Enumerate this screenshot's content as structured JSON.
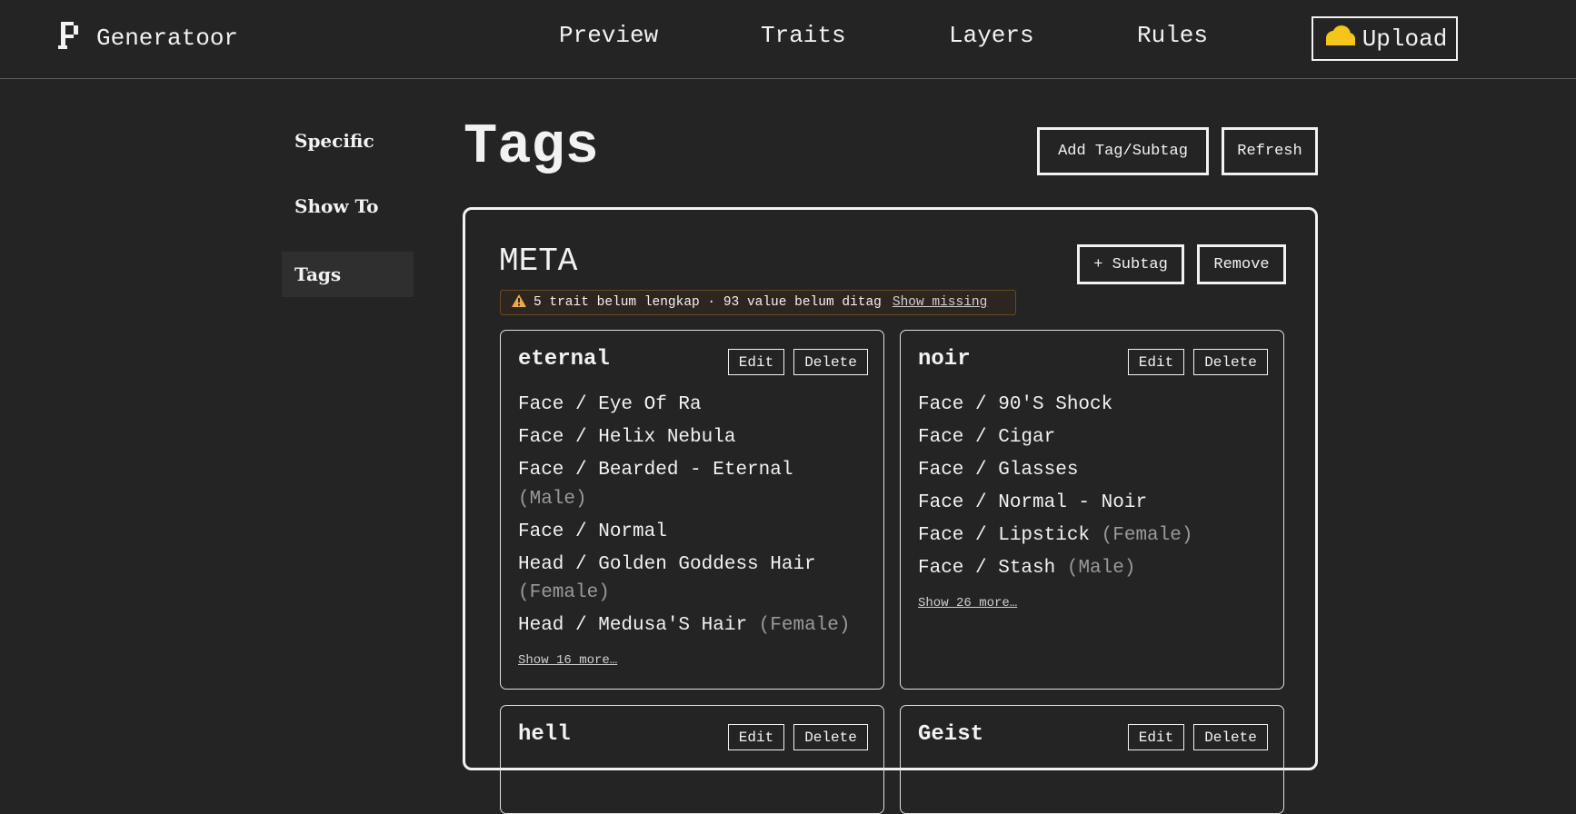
{
  "header": {
    "brand": "Generatoor",
    "nav": [
      "Preview",
      "Traits",
      "Layers",
      "Rules"
    ],
    "upload_label": "Upload"
  },
  "sidebar": {
    "items": [
      {
        "label": "Specific",
        "active": false
      },
      {
        "label": "Show To",
        "active": false
      },
      {
        "label": "Tags",
        "active": true
      }
    ]
  },
  "page": {
    "title": "Tags",
    "add_label": "Add Tag/Subtag",
    "refresh_label": "Refresh"
  },
  "tag": {
    "name": "META",
    "subtag_label": "+ Subtag",
    "remove_label": "Remove",
    "warning": "5 trait belum lengkap · 93 value belum ditag",
    "show_missing": "Show missing",
    "warning_color": "#f0a848",
    "subtags": [
      {
        "name": "eternal",
        "edit": "Edit",
        "delete": "Delete",
        "items": [
          {
            "text": "Face / Eye Of Ra",
            "note": ""
          },
          {
            "text": "Face / Helix Nebula",
            "note": ""
          },
          {
            "text": "Face / Bearded - Eternal",
            "note": "(Male)"
          },
          {
            "text": "Face / Normal",
            "note": ""
          },
          {
            "text": "Head / Golden Goddess Hair",
            "note": "(Female)"
          },
          {
            "text": "Head / Medusa'S Hair",
            "note": "(Female)"
          }
        ],
        "more": "Show 16 more…"
      },
      {
        "name": "noir",
        "edit": "Edit",
        "delete": "Delete",
        "items": [
          {
            "text": "Face / 90'S Shock",
            "note": ""
          },
          {
            "text": "Face / Cigar",
            "note": ""
          },
          {
            "text": "Face / Glasses",
            "note": ""
          },
          {
            "text": "Face / Normal - Noir",
            "note": ""
          },
          {
            "text": "Face / Lipstick",
            "note": "(Female)"
          },
          {
            "text": "Face / Stash",
            "note": "(Male)"
          }
        ],
        "more": "Show 26 more…"
      },
      {
        "name": "hell",
        "edit": "Edit",
        "delete": "Delete"
      },
      {
        "name": "Geist",
        "edit": "Edit",
        "delete": "Delete"
      }
    ]
  },
  "colors": {
    "background": "#242424",
    "text": "#f2f2f2",
    "muted": "#9a9a9a",
    "cloud": "#f5c518"
  }
}
